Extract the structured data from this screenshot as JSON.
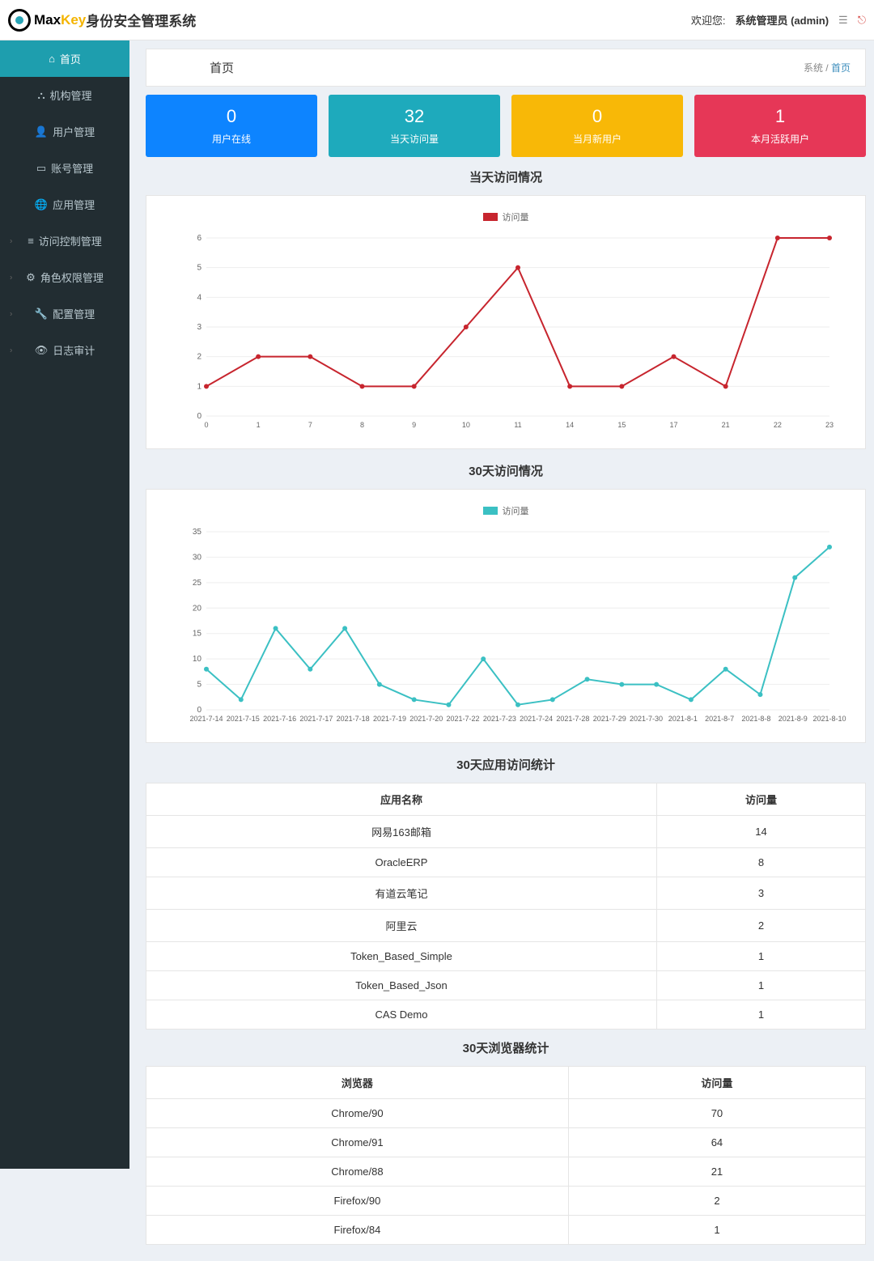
{
  "logo": {
    "max": "Max",
    "key": "Key",
    "suffix": "身份安全管理系统"
  },
  "header": {
    "welcome": "欢迎您:",
    "user": "系统管理员 (admin)"
  },
  "sidebar": {
    "items": [
      {
        "label": "首页",
        "icon": "home-icon",
        "active": true
      },
      {
        "label": "机构管理",
        "icon": "sitemap-icon"
      },
      {
        "label": "用户管理",
        "icon": "user-icon"
      },
      {
        "label": "账号管理",
        "icon": "idcard-icon"
      },
      {
        "label": "应用管理",
        "icon": "globe-icon"
      },
      {
        "label": "访问控制管理",
        "icon": "sliders-icon",
        "expandable": true
      },
      {
        "label": "角色权限管理",
        "icon": "cogs-icon",
        "expandable": true
      },
      {
        "label": "配置管理",
        "icon": "wrench-icon",
        "expandable": true
      },
      {
        "label": "日志审计",
        "icon": "eye-icon",
        "expandable": true
      }
    ]
  },
  "breadcrumb": {
    "title": "首页",
    "root": "系统",
    "sep": " / ",
    "current": "首页"
  },
  "cards": [
    {
      "value": "0",
      "label": "用户在线",
      "cls": "c-blue"
    },
    {
      "value": "32",
      "label": "当天访问量",
      "cls": "c-teal"
    },
    {
      "value": "0",
      "label": "当月新用户",
      "cls": "c-yellow"
    },
    {
      "value": "1",
      "label": "本月活跃用户",
      "cls": "c-red"
    }
  ],
  "chart1_title": "当天访问情况",
  "chart2_title": "30天访问情况",
  "legend_label": "访问量",
  "table_apps_title": "30天应用访问统计",
  "table_apps": {
    "headers": [
      "应用名称",
      "访问量"
    ],
    "rows": [
      [
        "网易163邮箱",
        "14"
      ],
      [
        "OracleERP",
        "8"
      ],
      [
        "有道云笔记",
        "3"
      ],
      [
        "阿里云",
        "2"
      ],
      [
        "Token_Based_Simple",
        "1"
      ],
      [
        "Token_Based_Json",
        "1"
      ],
      [
        "CAS Demo",
        "1"
      ]
    ]
  },
  "table_browsers_title": "30天浏览器统计",
  "table_browsers": {
    "headers": [
      "浏览器",
      "访问量"
    ],
    "rows": [
      [
        "Chrome/90",
        "70"
      ],
      [
        "Chrome/91",
        "64"
      ],
      [
        "Chrome/88",
        "21"
      ],
      [
        "Firefox/90",
        "2"
      ],
      [
        "Firefox/84",
        "1"
      ]
    ]
  },
  "chart_data": [
    {
      "type": "line",
      "title": "当天访问情况",
      "legend": "访问量",
      "color": "#c7252e",
      "categories": [
        "0",
        "1",
        "7",
        "8",
        "9",
        "10",
        "11",
        "14",
        "15",
        "17",
        "21",
        "22",
        "23"
      ],
      "values": [
        1,
        2,
        2,
        1,
        1,
        3,
        5,
        1,
        1,
        2,
        1,
        6,
        6
      ],
      "ylim": [
        0,
        6
      ],
      "yticks": [
        0,
        1,
        2,
        3,
        4,
        5,
        6
      ]
    },
    {
      "type": "line",
      "title": "30天访问情况",
      "legend": "访问量",
      "color": "#3bc0c3",
      "categories": [
        "2021-7-14",
        "2021-7-15",
        "2021-7-16",
        "2021-7-17",
        "2021-7-18",
        "2021-7-19",
        "2021-7-20",
        "2021-7-22",
        "2021-7-23",
        "2021-7-24",
        "2021-7-28",
        "2021-7-29",
        "2021-7-30",
        "2021-8-1",
        "2021-8-7",
        "2021-8-8",
        "2021-8-9",
        "2021-8-10"
      ],
      "values": [
        8,
        2,
        16,
        8,
        16,
        5,
        2,
        1,
        10,
        1,
        2,
        6,
        5,
        5,
        2,
        8,
        3,
        26,
        32
      ],
      "ylim": [
        0,
        35
      ],
      "yticks": [
        0,
        5,
        10,
        15,
        20,
        25,
        30,
        35
      ],
      "note": "values array has 19 entries; the last two points (26, 32) correspond to 2021-8-9 and 2021-8-10 with an intermediate unlabeled tick"
    }
  ]
}
